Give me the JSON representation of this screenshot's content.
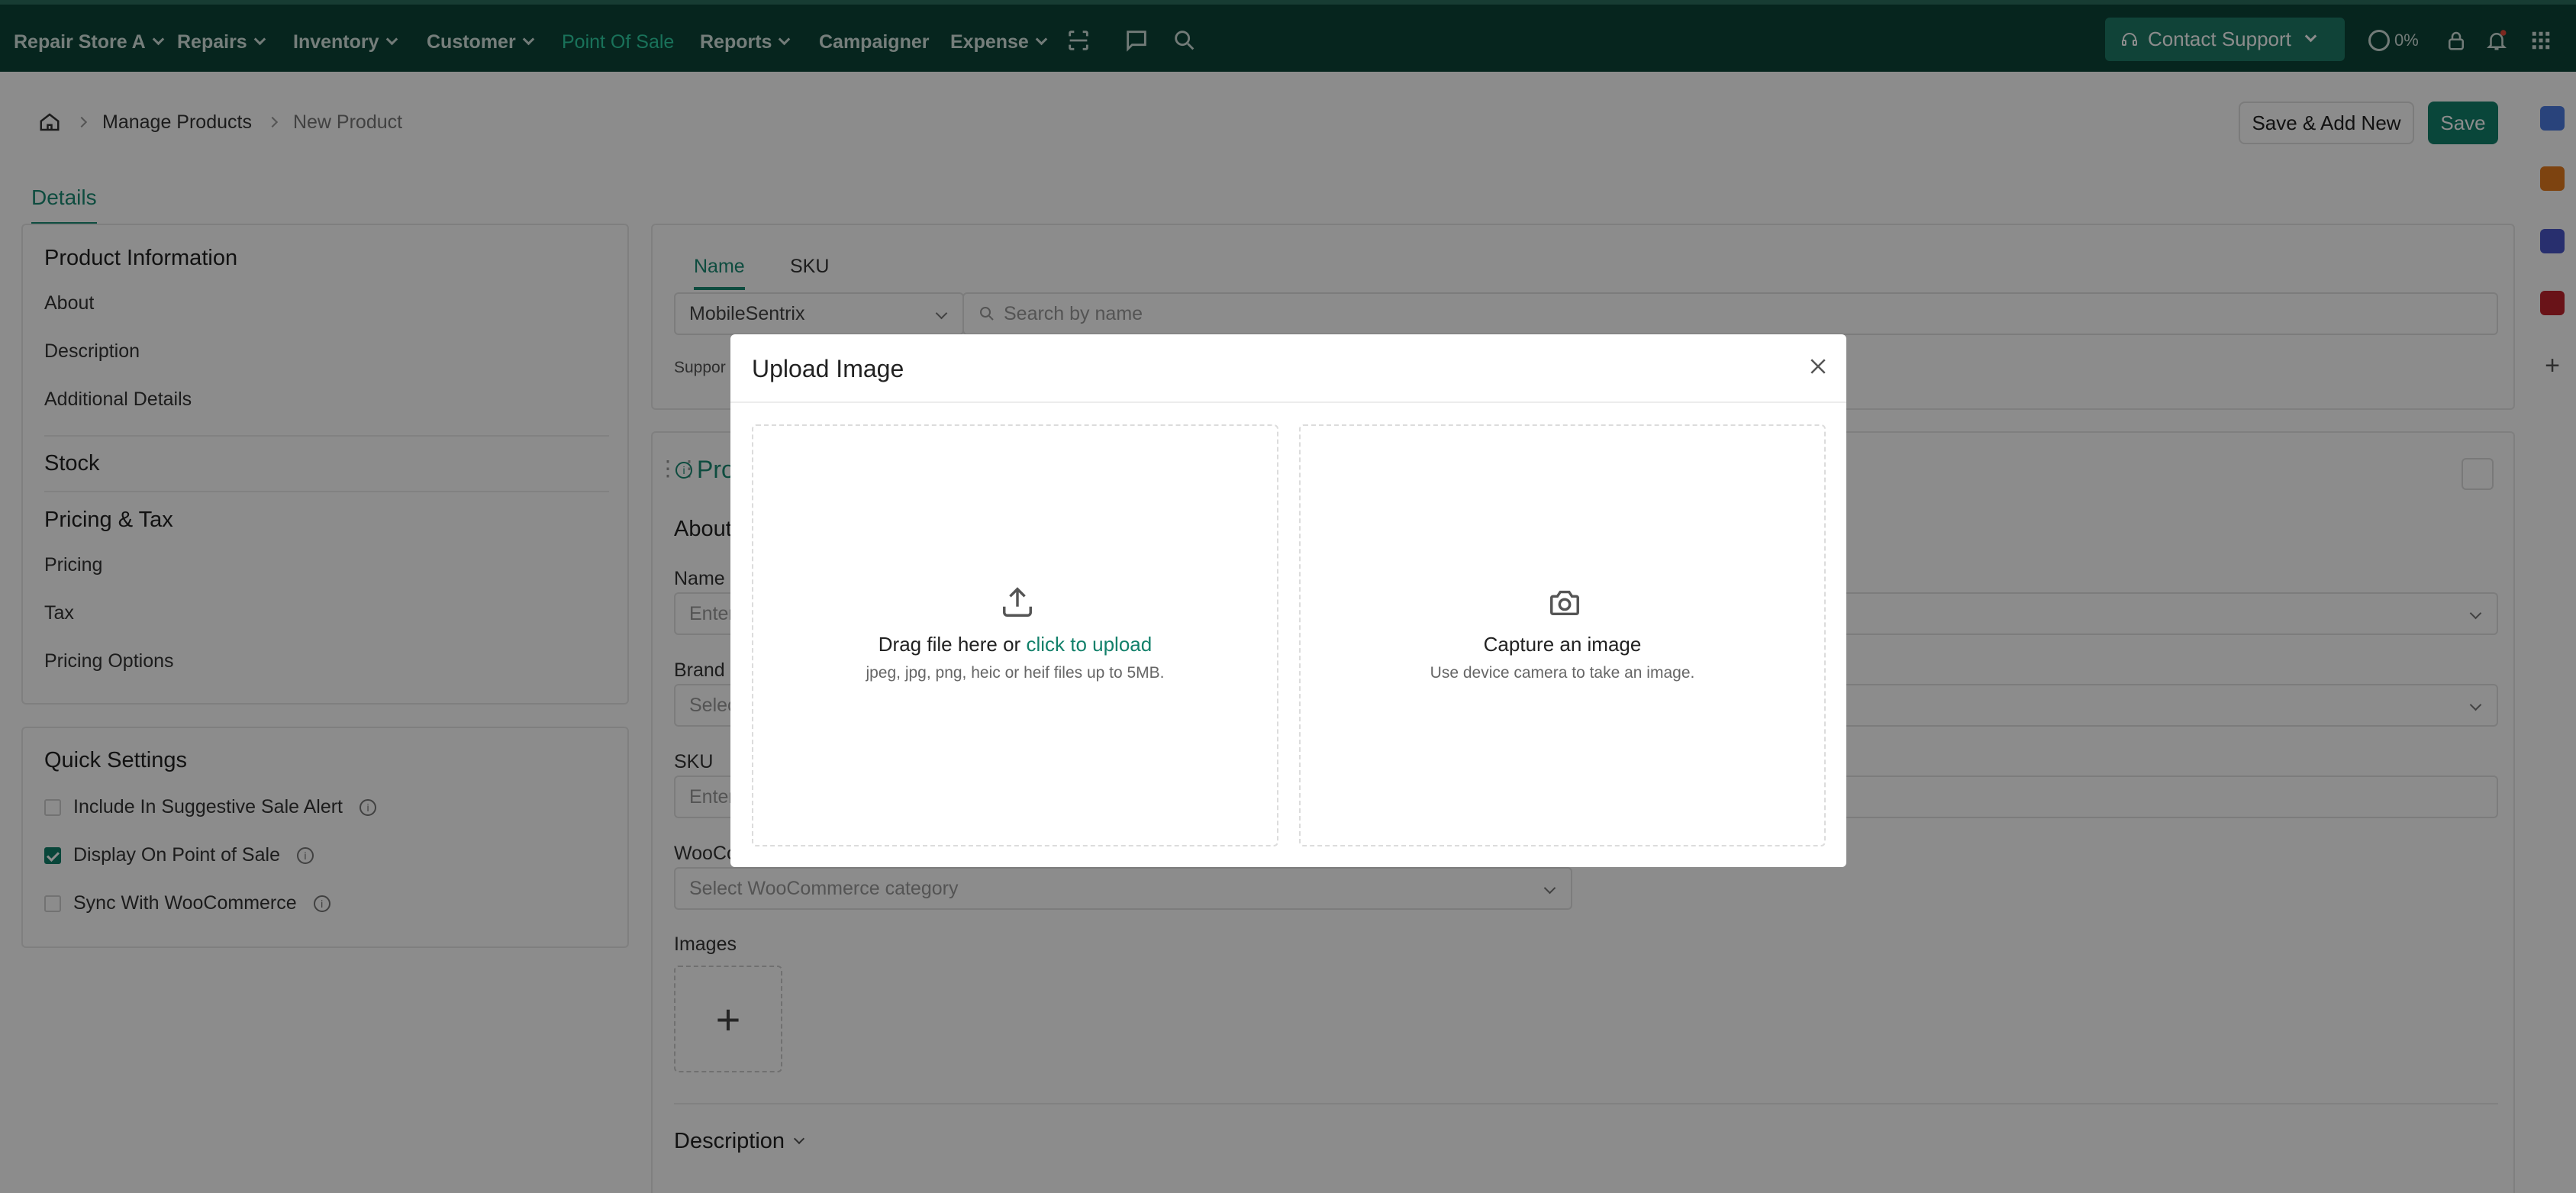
{
  "nav": {
    "store": "Repair Store A",
    "items": [
      "Repairs",
      "Inventory",
      "Customer",
      "Point Of Sale",
      "Reports",
      "Campaigner",
      "Expense"
    ],
    "contact_support": "Contact Support",
    "progress": "0%"
  },
  "breadcrumb": {
    "parent": "Manage Products",
    "current": "New Product"
  },
  "actions": {
    "save_add_new": "Save & Add New",
    "save": "Save"
  },
  "tabs": {
    "details": "Details"
  },
  "side": {
    "product_information": "Product Information",
    "about": "About",
    "description": "Description",
    "additional_details": "Additional Details",
    "stock": "Stock",
    "pricing_tax": "Pricing & Tax",
    "pricing": "Pricing",
    "tax": "Tax",
    "pricing_options": "Pricing Options"
  },
  "quick_settings": {
    "title": "Quick Settings",
    "items": [
      {
        "label": "Include In Suggestive Sale Alert",
        "checked": false
      },
      {
        "label": "Display On Point of Sale",
        "checked": true
      },
      {
        "label": "Sync With WooCommerce",
        "checked": false
      }
    ]
  },
  "main": {
    "tab_name": "Name",
    "tab_sku": "SKU",
    "supplier": "MobileSentrix",
    "search_placeholder": "Search by name",
    "supported_prefix": "Suppor",
    "section_prefix": "Pro",
    "about_prefix": "About",
    "name_label": "Name",
    "name_placeholder": "Enter",
    "brand_label": "Brand",
    "brand_placeholder": "Selec",
    "sku_label": "SKU",
    "sku_placeholder": "Enter",
    "woo_label": "WooCo",
    "woo_placeholder": "Select WooCommerce category",
    "images_label": "Images",
    "description_label": "Description"
  },
  "modal": {
    "title": "Upload Image",
    "upload_text": "Drag file here or",
    "upload_link": "click to upload",
    "upload_hint": "jpeg, jpg, png, heic or heif files up to 5MB.",
    "capture_title": "Capture an image",
    "capture_hint": "Use device camera to take an image."
  },
  "colors": {
    "nav_bg": "#0c4437",
    "accent": "#12806a"
  }
}
